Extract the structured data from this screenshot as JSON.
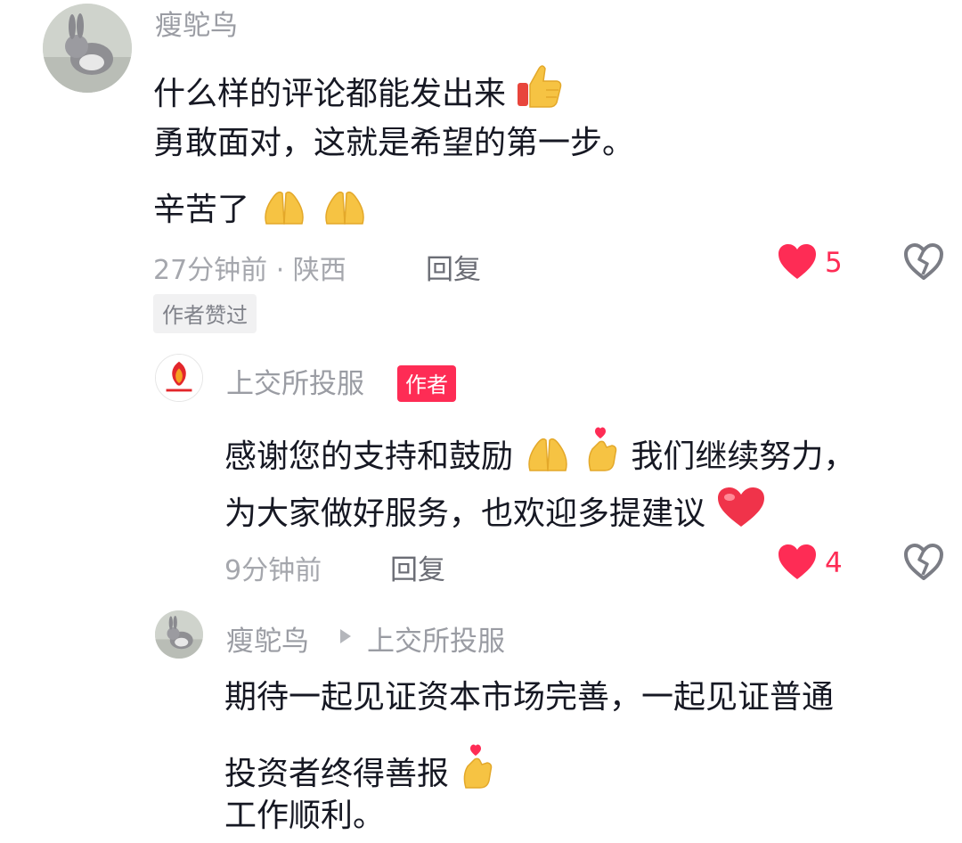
{
  "comment1": {
    "username": "瘦鸵鸟",
    "lines": [
      "什么样的评论都能发出来",
      "勇敢面对，这就是希望的第一步。",
      "辛苦了"
    ],
    "time_location": "27分钟前 · 陕西",
    "reply_label": "回复",
    "like_count": "5",
    "author_liked_label": "作者赞过"
  },
  "reply1": {
    "username": "上交所投服",
    "author_badge": "作者",
    "lines": [
      "感谢您的支持和鼓励",
      "我们继续努力，",
      "为大家做好服务，也欢迎多提建议"
    ],
    "time": "9分钟前",
    "reply_label": "回复",
    "like_count": "4"
  },
  "reply2": {
    "username": "瘦鸵鸟",
    "reply_to": "上交所投服",
    "lines": [
      "期待一起见证资本市场完善，一起见证普通",
      "投资者终得善报",
      "工作顺利。"
    ]
  },
  "icons": {
    "like": "heart-filled-icon",
    "dislike": "broken-heart-icon",
    "thumbs_up_emoji": "thumbs-up-emoji",
    "pray_emoji": "pray-emoji",
    "finger_heart_emoji": "finger-heart-emoji",
    "red_heart_emoji": "red-heart-emoji",
    "reply_arrow": "triangle-right-icon"
  },
  "colors": {
    "accent": "#fe2c55",
    "text": "#161823",
    "muted": "#9a9ca3"
  }
}
